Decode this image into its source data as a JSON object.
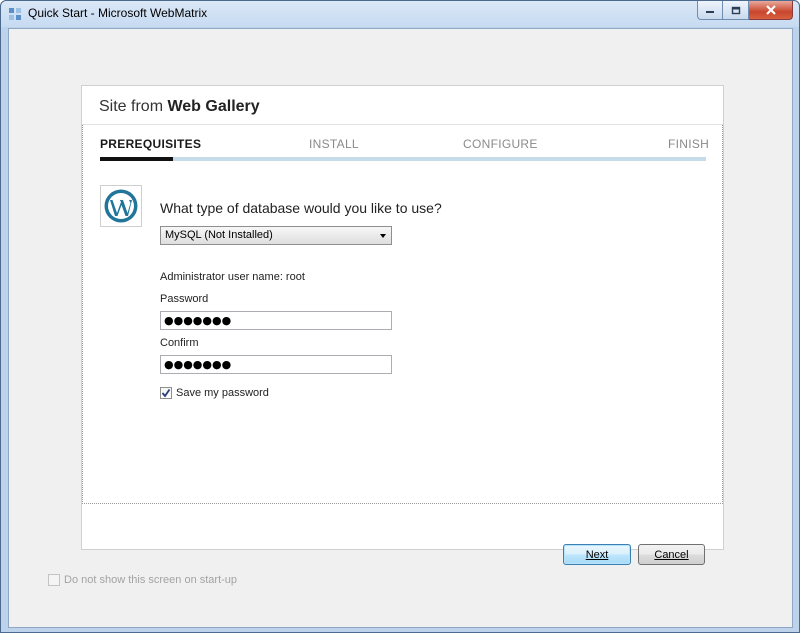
{
  "window": {
    "title": "Quick Start - Microsoft WebMatrix"
  },
  "dialog": {
    "title_prefix": "Site from ",
    "title_bold": "Web Gallery",
    "steps": [
      {
        "label": "PREREQUISITES",
        "active": true
      },
      {
        "label": "INSTALL",
        "active": false
      },
      {
        "label": "CONFIGURE",
        "active": false
      },
      {
        "label": "FINISH",
        "active": false
      }
    ],
    "progress": 0.12,
    "logo": "wordpress-logo-icon",
    "question": "What type of database would you like to use?",
    "database_select": {
      "value": "MySQL (Not Installed)"
    },
    "admin_user_label": "Administrator user name: root",
    "password": {
      "label": "Password",
      "value": "●●●●●●●"
    },
    "confirm": {
      "label": "Confirm",
      "value": "●●●●●●●"
    },
    "save_password": {
      "label": "Save my password",
      "checked": true
    },
    "buttons": {
      "next": "Next",
      "cancel": "Cancel"
    }
  },
  "footer": {
    "startup_checkbox": {
      "label": "Do not show this screen on start-up",
      "checked": false,
      "enabled": false
    }
  },
  "colors": {
    "progress_fill": "#111111",
    "progress_track": "#c5dbe8",
    "wordpress_blue": "#21759b"
  }
}
